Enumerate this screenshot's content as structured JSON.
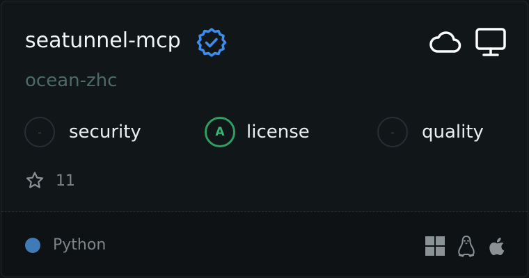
{
  "server": {
    "name": "seatunnel-mcp",
    "owner": "ocean-zhc",
    "verified_icon": "verified-badge-icon",
    "hosting_icons": [
      "cloud-icon",
      "desktop-icon"
    ]
  },
  "scores": [
    {
      "grade": "-",
      "label": "security"
    },
    {
      "grade": "A",
      "label": "license"
    },
    {
      "grade": "-",
      "label": "quality"
    }
  ],
  "stars": {
    "icon": "star-icon",
    "count": "11"
  },
  "footer": {
    "language": "Python",
    "language_color": "#3f7bb6",
    "platform_icons": [
      "windows-icon",
      "linux-icon",
      "apple-icon"
    ]
  },
  "colors": {
    "background": "#111618",
    "verified": "#3b8ef0",
    "grade_a": "#2e9e62",
    "owner_text": "#4e6a68"
  }
}
